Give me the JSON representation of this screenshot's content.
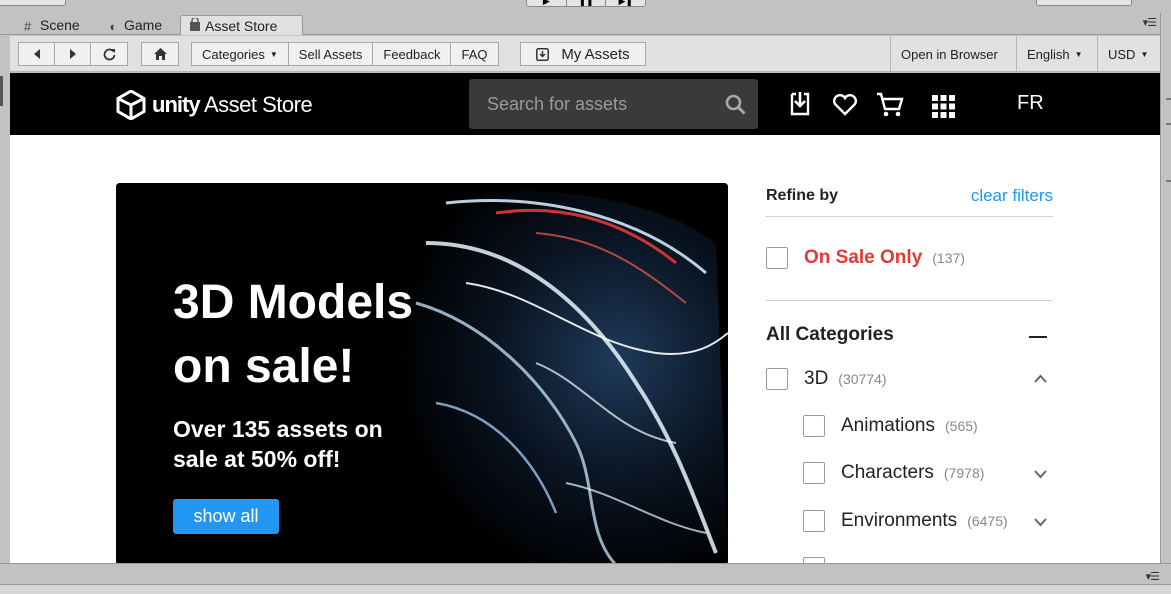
{
  "tabs": [
    {
      "label": "Scene",
      "icon": "grid-icon"
    },
    {
      "label": "Game",
      "icon": "pacman-icon"
    },
    {
      "label": "Asset Store",
      "icon": "shopping-bag-icon",
      "active": true
    }
  ],
  "toolbar": {
    "back_icon": "arrow-left-icon",
    "forward_icon": "arrow-right-icon",
    "reload_icon": "reload-icon",
    "home_icon": "home-icon",
    "categories_label": "Categories",
    "sell_assets_label": "Sell Assets",
    "feedback_label": "Feedback",
    "faq_label": "FAQ",
    "my_assets_label": "My Assets",
    "open_in_browser_label": "Open in Browser",
    "language_label": "English",
    "currency_label": "USD"
  },
  "header": {
    "logo_unity": "unity",
    "logo_store": "Asset Store",
    "search_placeholder": "Search for assets",
    "language_short": "FR"
  },
  "banner": {
    "title": "3D Models on sale!",
    "subtitle": "Over 135 assets on sale at 50% off!",
    "button_label": "show all"
  },
  "refine": {
    "title": "Refine by",
    "clear_label": "clear filters",
    "on_sale_label": "On Sale Only",
    "on_sale_count": "(137)",
    "all_categories_label": "All Categories",
    "categories": [
      {
        "label": "3D",
        "count": "(30774)"
      },
      {
        "label": "Animations",
        "count": "(565)"
      },
      {
        "label": "Characters",
        "count": "(7978)"
      },
      {
        "label": "Environments",
        "count": "(6475)"
      }
    ]
  },
  "colors": {
    "accent": "#2196f3",
    "sale": "#e53935",
    "header_bg": "#000000",
    "editor_bg": "#c2c2c2"
  }
}
